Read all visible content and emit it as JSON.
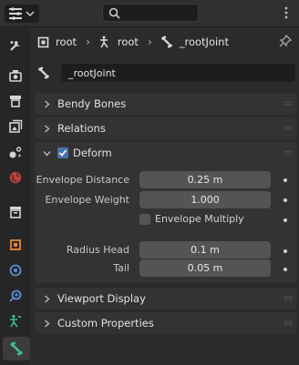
{
  "header": {
    "editor_type": "properties-icon",
    "search_placeholder": ""
  },
  "tabs": [
    {
      "name": "tool-icon"
    },
    {
      "name": "render-icon"
    },
    {
      "name": "output-icon"
    },
    {
      "name": "view-layer-icon"
    },
    {
      "name": "scene-icon"
    },
    {
      "name": "world-icon"
    },
    {
      "name": "collection-icon"
    },
    {
      "name": "object-icon"
    },
    {
      "name": "modifier-icon"
    },
    {
      "name": "physics-icon"
    },
    {
      "name": "armature-data-icon"
    },
    {
      "name": "bone-icon",
      "active": true
    }
  ],
  "breadcrumb": {
    "items": [
      "root",
      "root",
      "_rootJoint"
    ]
  },
  "bone_name": "_rootJoint",
  "panels": {
    "bendy_bones": "Bendy Bones",
    "relations": "Relations",
    "deform": {
      "label": "Deform",
      "checked": true,
      "envelope_distance_label": "Envelope Distance",
      "envelope_distance_value": "0.25 m",
      "envelope_weight_label": "Envelope Weight",
      "envelope_weight_value": "1.000",
      "envelope_multiply_label": "Envelope Multiply",
      "radius_head_label": "Radius Head",
      "radius_head_value": "0.1 m",
      "tail_label": "Tail",
      "tail_value": "0.05 m"
    },
    "viewport_display": "Viewport Display",
    "custom_properties": "Custom Properties"
  },
  "colors": {
    "accent": "#4772b3",
    "tab_active": "#3c3c3c",
    "panel": "#333333"
  }
}
